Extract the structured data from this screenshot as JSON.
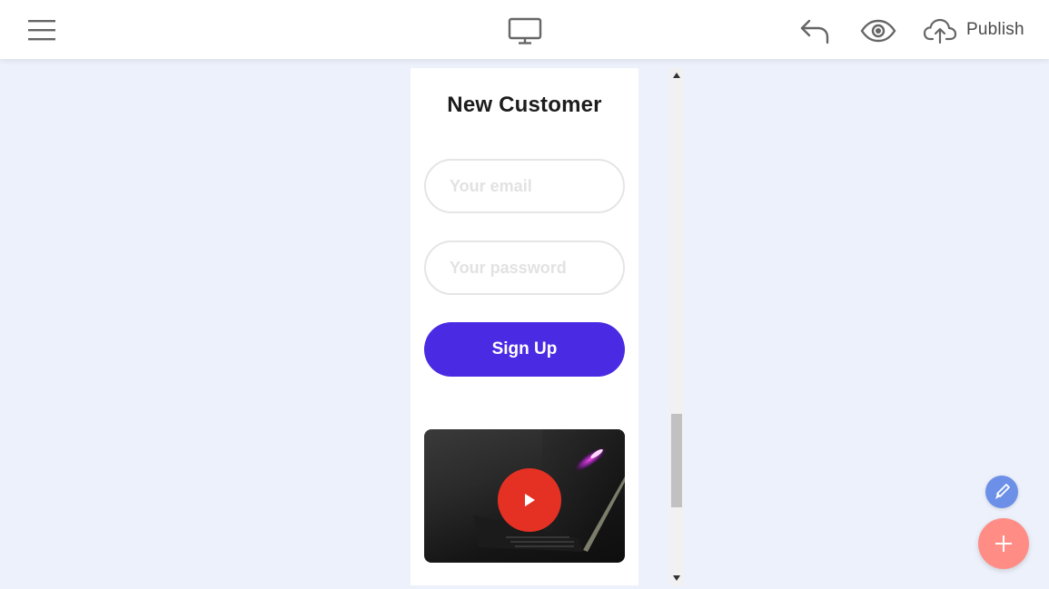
{
  "toolbar": {
    "menu_icon": "hamburger-menu-icon",
    "device_icon": "desktop-monitor-icon",
    "undo_icon": "undo-arrow-icon",
    "preview_icon": "eye-icon",
    "publish_icon": "cloud-upload-icon",
    "publish_label": "Publish"
  },
  "form": {
    "title": "New Customer",
    "email": {
      "value": "",
      "placeholder": "Your email"
    },
    "password": {
      "value": "",
      "placeholder": "Your password"
    },
    "signup_label": "Sign Up"
  },
  "video": {
    "thumbnail": "laptop-dark-photo",
    "play_icon": "play-icon"
  },
  "fabs": {
    "edit_icon": "brush-icon",
    "add_icon": "plus-icon"
  },
  "colors": {
    "background": "#edf1fb",
    "accent": "#4a2ae3",
    "play_button": "#e53124",
    "fab_edit": "#6c8fe8",
    "fab_add": "#ff8d86"
  }
}
